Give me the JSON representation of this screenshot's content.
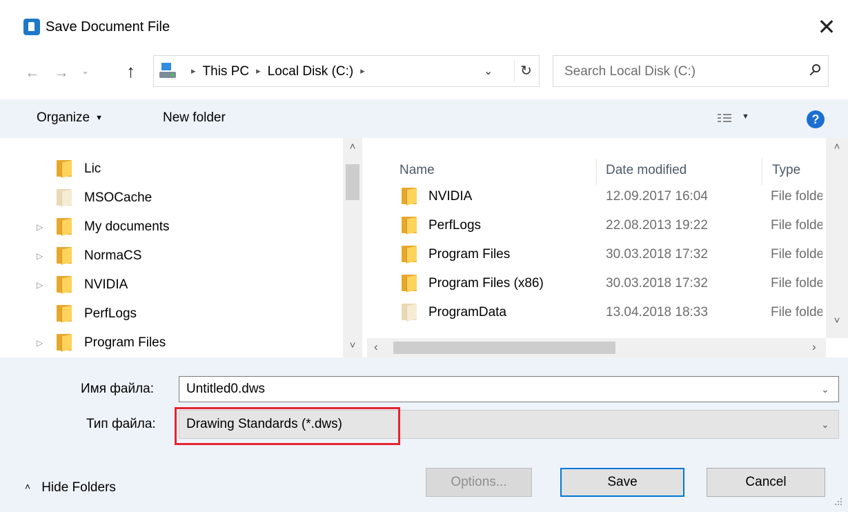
{
  "window": {
    "title": "Save Document File",
    "close_glyph": "✕"
  },
  "nav": {
    "back_glyph": "←",
    "forward_glyph": "→",
    "recent_glyph": "⌄",
    "up_glyph": "↑",
    "breadcrumbs": [
      "This PC",
      "Local Disk (C:)"
    ],
    "crumb_sep": "▸",
    "dropdown_glyph": "⌄",
    "refresh_glyph": "↻",
    "search_placeholder": "Search Local Disk (C:)"
  },
  "toolbar": {
    "organize_label": "Organize",
    "caret": "▼",
    "new_folder_label": "New folder",
    "help_glyph": "?"
  },
  "tree": {
    "items": [
      {
        "label": "Lic",
        "expandable": false,
        "pale": false
      },
      {
        "label": "MSOCache",
        "expandable": false,
        "pale": true
      },
      {
        "label": "My documents",
        "expandable": true,
        "pale": false
      },
      {
        "label": "NormaCS",
        "expandable": true,
        "pale": false
      },
      {
        "label": "NVIDIA",
        "expandable": true,
        "pale": false
      },
      {
        "label": "PerfLogs",
        "expandable": false,
        "pale": false
      },
      {
        "label": "Program Files",
        "expandable": true,
        "pale": false
      }
    ],
    "expand_glyph": "▷",
    "scroll_up": "˄",
    "scroll_down": "˅"
  },
  "files": {
    "columns": {
      "name": "Name",
      "date": "Date modified",
      "type": "Type"
    },
    "rows": [
      {
        "name": "NVIDIA",
        "date": "12.09.2017 16:04",
        "type": "File folder",
        "pale": false
      },
      {
        "name": "PerfLogs",
        "date": "22.08.2013 19:22",
        "type": "File folder",
        "pale": false
      },
      {
        "name": "Program Files",
        "date": "30.03.2018 17:32",
        "type": "File folder",
        "pale": false
      },
      {
        "name": "Program Files (x86)",
        "date": "30.03.2018 17:32",
        "type": "File folder",
        "pale": false
      },
      {
        "name": "ProgramData",
        "date": "13.04.2018 18:33",
        "type": "File folder",
        "pale": true
      }
    ],
    "scroll_left": "‹",
    "scroll_right": "›",
    "scroll_up": "˄",
    "scroll_down": "˅"
  },
  "form": {
    "filename_label": "Имя файла:",
    "filename_value": "Untitled0.dws",
    "filetype_label": "Тип файла:",
    "filetype_value": "Drawing Standards (*.dws)",
    "dropdown_glyph": "⌄",
    "highlight_color": "#e5242e"
  },
  "footer": {
    "hide_folders_label": "Hide Folders",
    "hide_folders_glyph": "˄",
    "options_label": "Options...",
    "save_label": "Save",
    "cancel_label": "Cancel"
  },
  "colors": {
    "accent": "#0078d7",
    "panel_bg": "#eef3fa",
    "folder": "#ffd35c",
    "help_icon": "#1c6fd0"
  }
}
